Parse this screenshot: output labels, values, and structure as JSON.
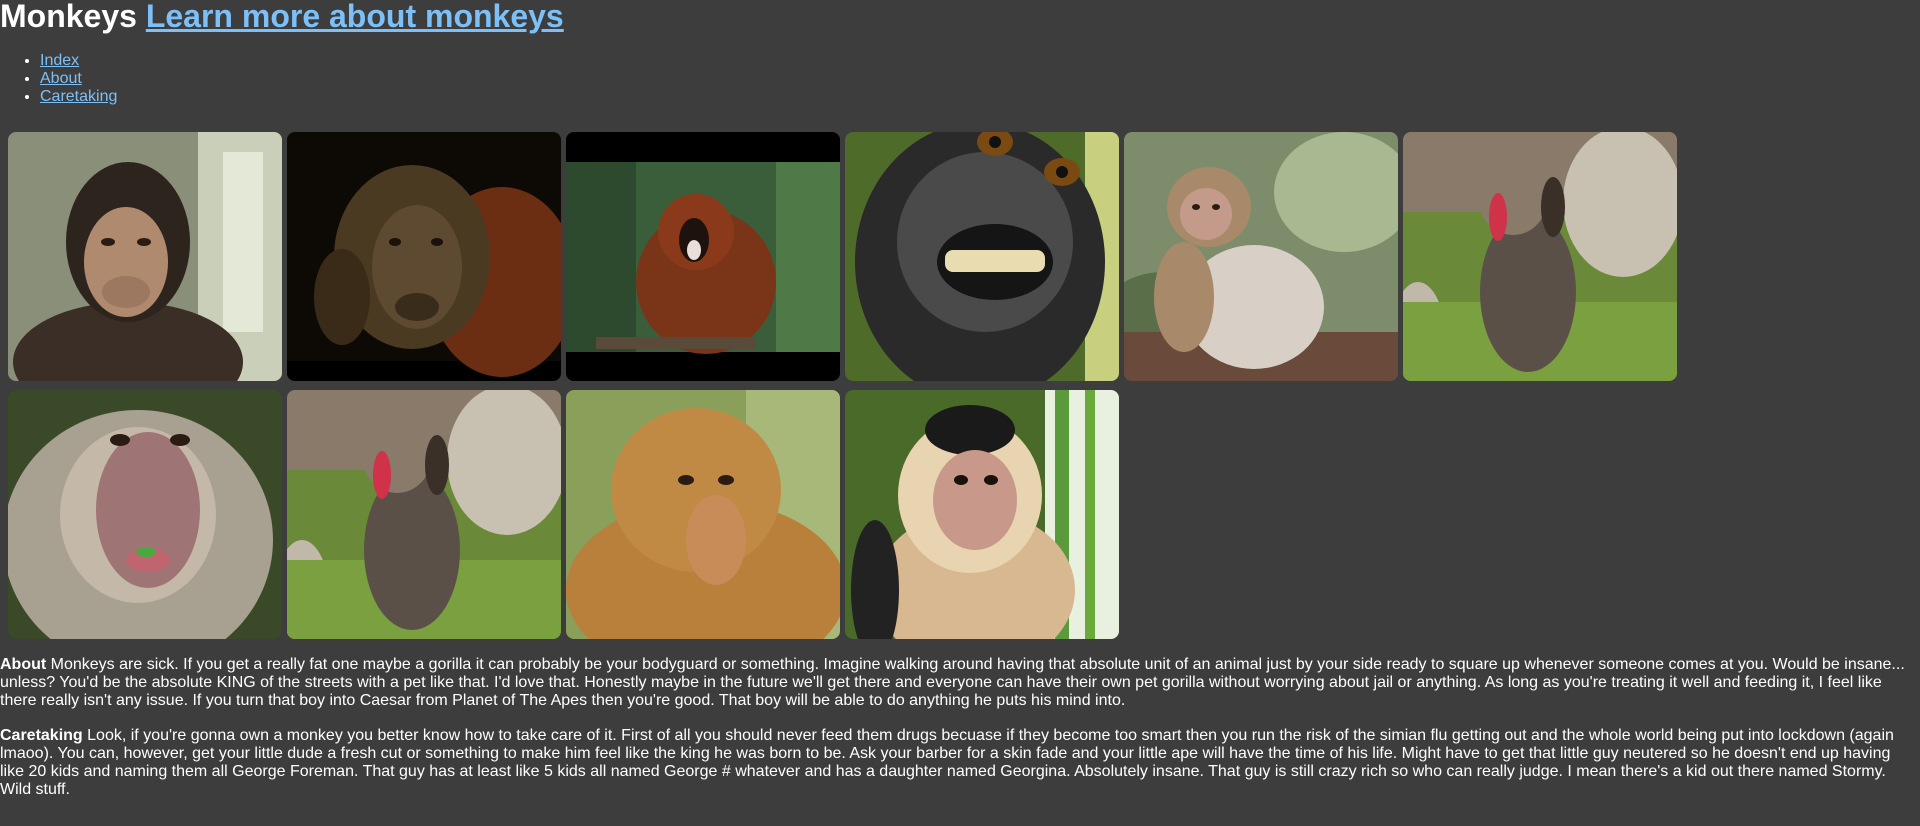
{
  "header": {
    "title": "Monkeys",
    "link": "Learn more about monkeys"
  },
  "nav": [
    {
      "label": "Index"
    },
    {
      "label": "About"
    },
    {
      "label": "Caretaking"
    }
  ],
  "sections": {
    "about": {
      "heading": "About",
      "body": "Monkeys are sick. If you get a really fat one maybe a gorilla it can probably be your bodyguard or something. Imagine walking around having that absolute unit of an animal just by your side ready to square up whenever someone comes at you. Would be insane... unless? You'd be the absolute KING of the streets with a pet like that. I'd love that. Honestly maybe in the future we'll get there and everyone can have their own pet gorilla without worrying about jail or anything. As long as you're treating it well and feeding it, I feel like there really isn't any issue. If you turn that boy into Caesar from Planet of The Apes then you're good. That boy will be able to do anything he puts his mind into."
    },
    "caretaking": {
      "heading": "Caretaking",
      "body": "Look, if you're gonna own a monkey you better know how to take care of it. First of all you should never feed them drugs becuase if they become too smart then you run the risk of the simian flu getting out and the whole world being put into lockdown (again lmaoo). You can, however, get your little dude a fresh cut or something to make him feel like the king he was born to be. Ask your barber for a skin fade and your little ape will have the time of his life. Might have to get that little guy neutered so he doesn't end up having like 20 kids and naming them all George Foreman. That guy has at least like 5 kids all named George # whatever and has a daughter named Georgina. Absolutely insane. That guy is still crazy rich so who can really judge. I mean there's a kid out there named Stormy. Wild stuff."
    }
  },
  "colors": {
    "background": "#3d3d3d",
    "text": "#ffffff",
    "link": "#7cc0f7"
  }
}
